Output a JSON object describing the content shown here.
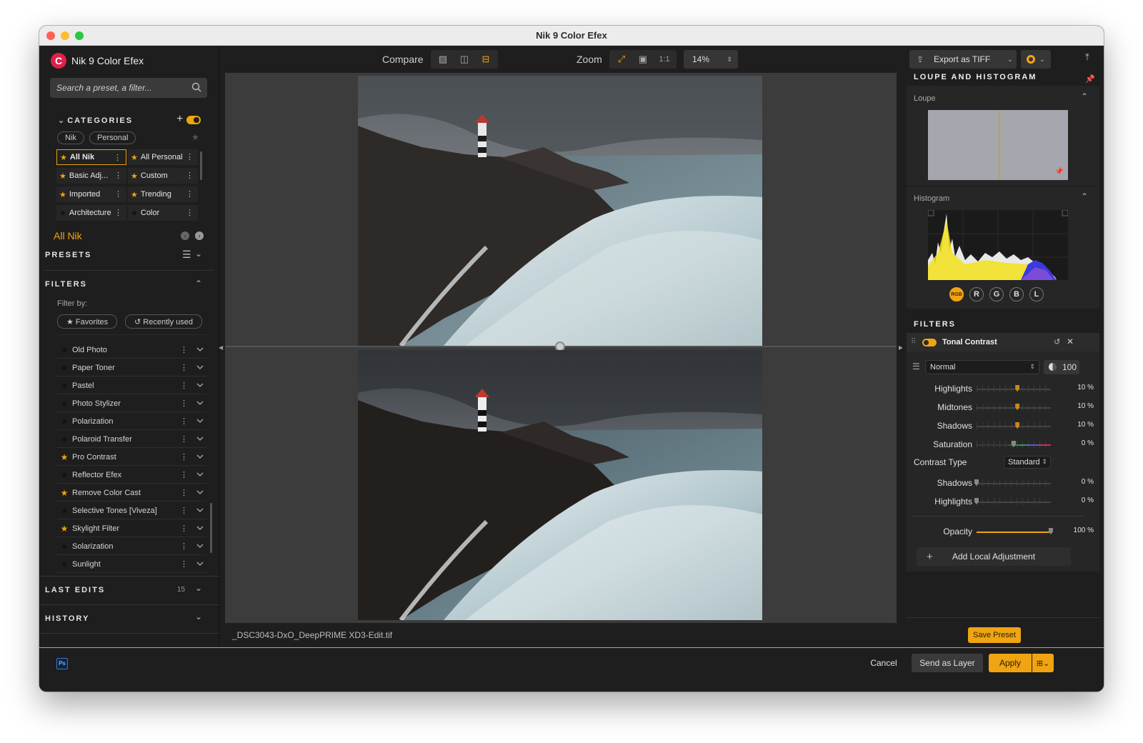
{
  "window": {
    "title": "Nik 9 Color Efex"
  },
  "app": {
    "name": "Nik 9 Color Efex",
    "logo_letter": "C"
  },
  "search": {
    "placeholder": "Search a preset, a filter..."
  },
  "categories": {
    "header": "CATEGORIES",
    "toggle_on": true,
    "tabs": [
      "Nik",
      "Personal"
    ],
    "items": [
      {
        "label": "All Nik",
        "starred": true,
        "selected": true
      },
      {
        "label": "All Personal",
        "starred": true
      },
      {
        "label": "Basic Adj...",
        "starred": true
      },
      {
        "label": "Custom",
        "starred": true
      },
      {
        "label": "Imported",
        "starred": true
      },
      {
        "label": "Trending",
        "starred": true
      },
      {
        "label": "Architecture",
        "starred": false
      },
      {
        "label": "Color",
        "starred": false
      }
    ],
    "current": "All Nik"
  },
  "presets": {
    "header": "PRESETS"
  },
  "filters_panel": {
    "header": "FILTERS",
    "filter_by": "Filter by:",
    "favorites": "Favorites",
    "recently_used": "Recently used",
    "items": [
      {
        "label": "Old Photo",
        "starred": false
      },
      {
        "label": "Paper Toner",
        "starred": false
      },
      {
        "label": "Pastel",
        "starred": false
      },
      {
        "label": "Photo Stylizer",
        "starred": false
      },
      {
        "label": "Polarization",
        "starred": false
      },
      {
        "label": "Polaroid Transfer",
        "starred": false
      },
      {
        "label": "Pro Contrast",
        "starred": true
      },
      {
        "label": "Reflector Efex",
        "starred": false
      },
      {
        "label": "Remove Color Cast",
        "starred": true
      },
      {
        "label": "Selective Tones [Viveza]",
        "starred": false
      },
      {
        "label": "Skylight Filter",
        "starred": true
      },
      {
        "label": "Solarization",
        "starred": false
      },
      {
        "label": "Sunlight",
        "starred": false
      }
    ]
  },
  "last_edits": {
    "header": "LAST EDITS",
    "count": "15"
  },
  "history": {
    "header": "HISTORY"
  },
  "toolbar": {
    "compare": "Compare",
    "zoom": "Zoom",
    "one_to_one": "1:1",
    "zoom_value": "14%"
  },
  "file": {
    "name": "_DSC3043-DxO_DeepPRIME XD3-Edit.tif"
  },
  "export": {
    "label": "Export as TIFF"
  },
  "loupe_histogram": {
    "header": "LOUPE AND HISTOGRAM",
    "loupe": "Loupe",
    "histogram": "Histogram",
    "channels": [
      "RGB",
      "R",
      "G",
      "B",
      "L"
    ],
    "active_channel": "RGB"
  },
  "filter_stack": {
    "header": "FILTERS",
    "filter_name": "Tonal Contrast",
    "blend_mode": "Normal",
    "blend_opacity": "100",
    "sliders": [
      {
        "label": "Highlights",
        "value": "10 %",
        "level": 0.55
      },
      {
        "label": "Midtones",
        "value": "10 %",
        "level": 0.55
      },
      {
        "label": "Shadows",
        "value": "10 %",
        "level": 0.55
      },
      {
        "label": "Saturation",
        "value": "0 %",
        "level": 0.5
      }
    ],
    "contrast_type_label": "Contrast Type",
    "contrast_type": "Standard",
    "sliders2": [
      {
        "label": "Shadows",
        "value": "0 %",
        "level": 0
      },
      {
        "label": "Highlights",
        "value": "0 %",
        "level": 0
      }
    ],
    "opacity_label": "Opacity",
    "opacity_value": "100 %",
    "opacity_level": 1.0,
    "add_local": "Add Local Adjustment"
  },
  "actions": {
    "save_preset": "Save Preset",
    "cancel": "Cancel",
    "send_as_layer": "Send as Layer",
    "apply": "Apply"
  },
  "colors": {
    "accent": "#f0a412",
    "panel": "#1e1e1e",
    "canvas": "#3c3c3c"
  }
}
